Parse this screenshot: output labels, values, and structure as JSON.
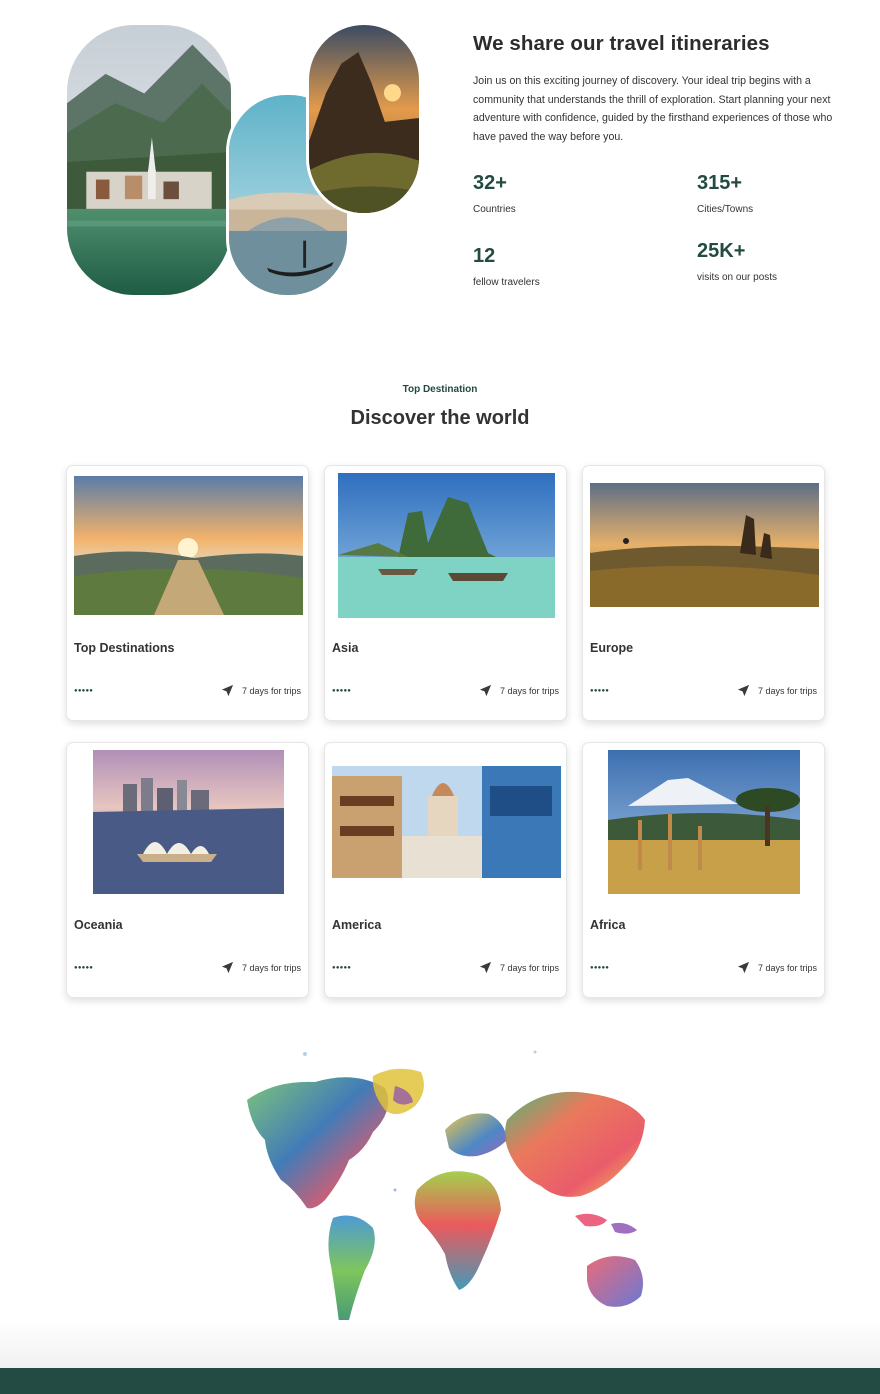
{
  "about": {
    "title": "We share our travel itineraries",
    "description": "Join us on this exciting journey of discovery. Your ideal trip begins with a community that understands the thrill of exploration. Start planning your next adventure with confidence, guided by the firsthand experiences of those who have paved the way before you.",
    "stats": [
      {
        "value": "32+",
        "label": "Countries"
      },
      {
        "value": "315+",
        "label": "Cities/Towns"
      },
      {
        "value": "12",
        "label": "fellow travelers"
      },
      {
        "value": "25K+",
        "label": "visits on our posts"
      }
    ]
  },
  "destinations": {
    "eyebrow": "Top Destination",
    "title": "Discover the world",
    "cards": [
      {
        "title": "Top Destinations",
        "rating": "●●●●●",
        "trip_label": "7 days for trips"
      },
      {
        "title": "Asia",
        "rating": "●●●●●",
        "trip_label": "7 days for trips"
      },
      {
        "title": "Europe",
        "rating": "●●●●●",
        "trip_label": "7 days for trips"
      },
      {
        "title": "Oceania",
        "rating": "●●●●●",
        "trip_label": "7 days for trips"
      },
      {
        "title": "America",
        "rating": "●●●●●",
        "trip_label": "7 days for trips"
      },
      {
        "title": "Africa",
        "rating": "●●●●●",
        "trip_label": "7 days for trips"
      }
    ]
  },
  "colors": {
    "brand": "#234a43",
    "text": "#333333"
  },
  "icons": {
    "trip": "navigation-arrow-icon",
    "rating": "dot-icon"
  }
}
